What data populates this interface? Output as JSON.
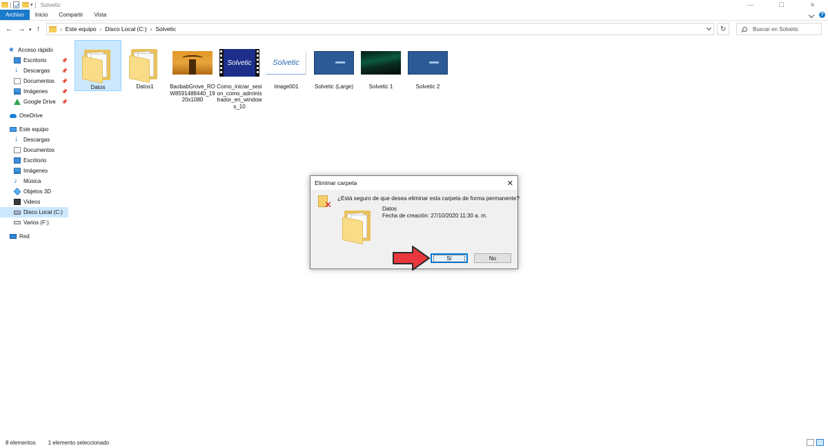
{
  "window": {
    "title": "Solvetic",
    "controls": {
      "minimize": "—",
      "maximize": "☐",
      "close": "✕"
    }
  },
  "ribbon": {
    "tabs": [
      "Archivo",
      "Inicio",
      "Compartir",
      "Vista"
    ],
    "active_tab": "Archivo"
  },
  "address": {
    "breadcrumbs": [
      "Este equipo",
      "Disco Local (C:)",
      "Solvetic"
    ],
    "search_placeholder": "Buscar en Solvetic"
  },
  "sidebar": {
    "items": [
      {
        "label": "Acceso rápido",
        "icon": "star-icon",
        "pinned": false
      },
      {
        "label": "Escritorio",
        "icon": "desktop-icon",
        "pinned": true
      },
      {
        "label": "Descargas",
        "icon": "download-icon",
        "pinned": true
      },
      {
        "label": "Documentos",
        "icon": "documents-icon",
        "pinned": true
      },
      {
        "label": "Imágenes",
        "icon": "pictures-icon",
        "pinned": true
      },
      {
        "label": "Google Drive",
        "icon": "google-drive-icon",
        "pinned": true
      },
      {
        "label": "OneDrive",
        "icon": "onedrive-icon",
        "pinned": false
      },
      {
        "label": "Este equipo",
        "icon": "computer-icon",
        "pinned": false
      },
      {
        "label": "Descargas",
        "icon": "download-icon",
        "pinned": false
      },
      {
        "label": "Documentos",
        "icon": "documents-icon",
        "pinned": false
      },
      {
        "label": "Escritorio",
        "icon": "desktop-icon",
        "pinned": false
      },
      {
        "label": "Imágenes",
        "icon": "pictures-icon",
        "pinned": false
      },
      {
        "label": "Música",
        "icon": "music-icon",
        "pinned": false
      },
      {
        "label": "Objetos 3D",
        "icon": "3d-objects-icon",
        "pinned": false
      },
      {
        "label": "Videos",
        "icon": "videos-icon",
        "pinned": false
      },
      {
        "label": "Disco Local (C:)",
        "icon": "drive-icon",
        "pinned": false,
        "selected": true
      },
      {
        "label": "Varios (F:)",
        "icon": "usb-drive-icon",
        "pinned": false
      },
      {
        "label": "Red",
        "icon": "network-icon",
        "pinned": false
      }
    ]
  },
  "files": [
    {
      "name": "Datos",
      "type": "folder",
      "selected": true
    },
    {
      "name": "Datos1",
      "type": "folder"
    },
    {
      "name": "BaobabGrove_ROW8591488440_1920x1080",
      "type": "image"
    },
    {
      "name": "Como_iniciar_sesion_como_administrador_en_windows_10",
      "type": "video",
      "thumb_text": "Solvetic"
    },
    {
      "name": "image001",
      "type": "image",
      "thumb_text": "Solvetic"
    },
    {
      "name": "Solvetic (Large)",
      "type": "image"
    },
    {
      "name": "Solvetic 1",
      "type": "image"
    },
    {
      "name": "Solvetic 2",
      "type": "image"
    }
  ],
  "dialog": {
    "title": "Eliminar carpeta",
    "close": "✕",
    "question": "¿Está seguro de que desea eliminar esta carpeta de forma permanente?",
    "item_name": "Datos",
    "item_date": "Fecha de creación: 27/10/2020 11:30 a. m.",
    "yes_label": "Sí",
    "no_label": "No"
  },
  "status": {
    "count": "8 elementos",
    "selection": "1 elemento seleccionado"
  },
  "colors": {
    "accent": "#1979ca",
    "selection": "#cce8ff",
    "arrow": "#e8373d"
  }
}
